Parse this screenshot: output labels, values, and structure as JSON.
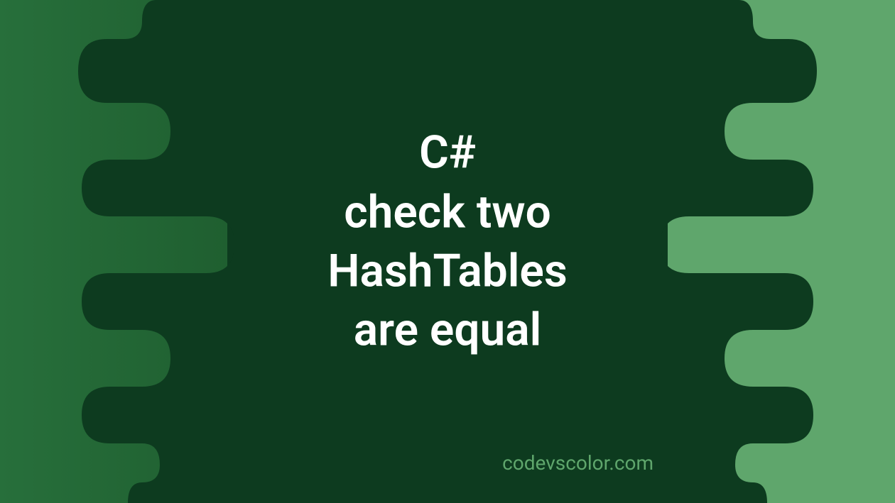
{
  "title": {
    "line1": "C#",
    "line2": "check two",
    "line3": "HashTables",
    "line4": "are equal"
  },
  "watermark": "codevscolor.com",
  "colors": {
    "darkBg": "#0d3b1f",
    "leftGreen": "#276f3b",
    "rightGreen": "#5fa66c",
    "textWhite": "#ffffff"
  }
}
